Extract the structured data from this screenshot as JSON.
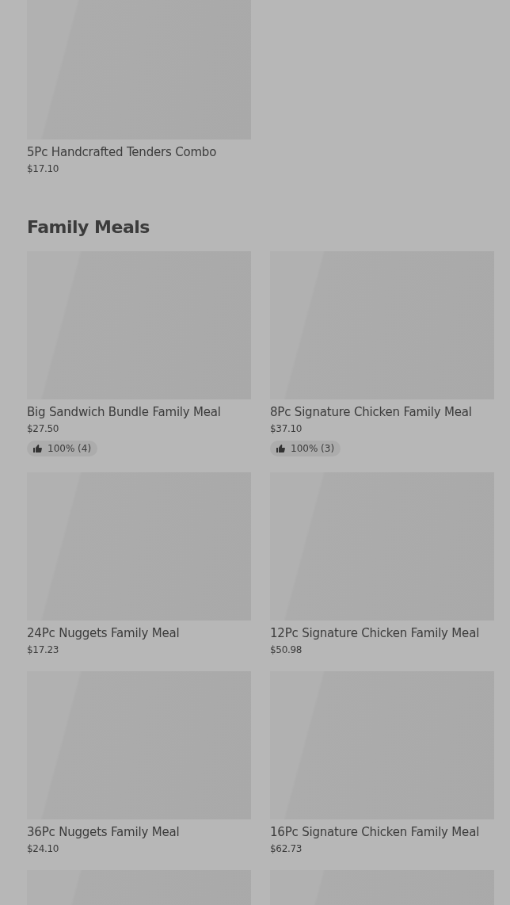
{
  "top_section": {
    "items": [
      {
        "kind": "item",
        "name": "5Pc Handcrafted Tenders Combo",
        "price": "$17.10"
      }
    ]
  },
  "family_meals": {
    "heading": "Family Meals",
    "items": [
      {
        "kind": "item",
        "name": "Big Sandwich Bundle Family Meal",
        "price": "$27.50",
        "rating": "100% (4)"
      },
      {
        "kind": "item",
        "name": "8Pc Signature Chicken Family Meal",
        "price": "$37.10",
        "rating": "100% (3)"
      },
      {
        "kind": "item",
        "name": "24Pc Nuggets Family Meal",
        "price": "$17.23"
      },
      {
        "kind": "item",
        "name": "12Pc Signature Chicken Family Meal",
        "price": "$50.98"
      },
      {
        "kind": "item",
        "name": "36Pc Nuggets Family Meal",
        "price": "$24.10"
      },
      {
        "kind": "item",
        "name": "16Pc Signature Chicken Family Meal",
        "price": "$62.73"
      },
      {
        "kind": "picture"
      },
      {
        "kind": "picture"
      }
    ]
  }
}
